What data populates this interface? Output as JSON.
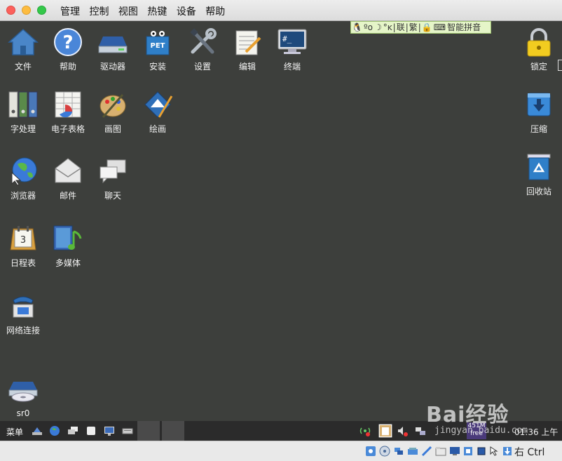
{
  "menu": [
    "管理",
    "控制",
    "视图",
    "热键",
    "设备",
    "帮助"
  ],
  "ime_bar": [
    "联",
    "繁",
    "智能拼音"
  ],
  "desktop_icons": {
    "file": "文件",
    "help": "帮助",
    "drives": "驱动器",
    "install": "安装",
    "settings": "设置",
    "edit": "编辑",
    "terminal": "终端",
    "lock": "锁定",
    "wordproc": "字处理",
    "spreadsheet": "电子表格",
    "paint": "画图",
    "draw": "绘画",
    "compress": "压缩",
    "browser": "浏览器",
    "mail": "邮件",
    "chat": "聊天",
    "recycle": "回收站",
    "calendar": "日程表",
    "multimedia": "多媒体",
    "network": "网络连接",
    "sr0": "sr0"
  },
  "icon_glyphs": {
    "install_label": "PET",
    "terminal_prompt": "#_",
    "calendar_day": "3"
  },
  "taskbar": {
    "start": "菜单",
    "mem_line1": "451M",
    "mem_line2": "free",
    "clock": "01:36 上午"
  },
  "watermark": {
    "logo": "Bai经验",
    "url": "jingyan.baidu.com"
  },
  "statusbar": {
    "host_key": "右 Ctrl"
  }
}
